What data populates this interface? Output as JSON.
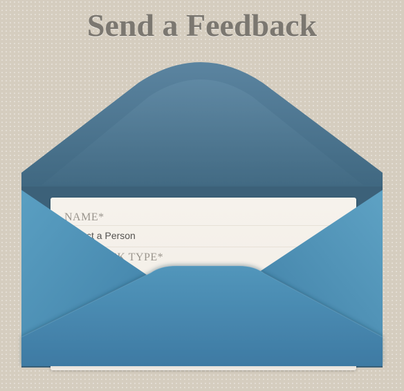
{
  "page": {
    "title": "Send a Feedback"
  },
  "form": {
    "name_label": "NAME*",
    "name_select_value": "Select a Person",
    "feedback_type_label": "FEEDBACK TYPE*"
  },
  "colors": {
    "background": "#d5cdbf",
    "title": "#7b7770",
    "envelope_back": "#4d7590",
    "envelope_front": "#4a90b5",
    "letter": "#f4f0ea"
  }
}
